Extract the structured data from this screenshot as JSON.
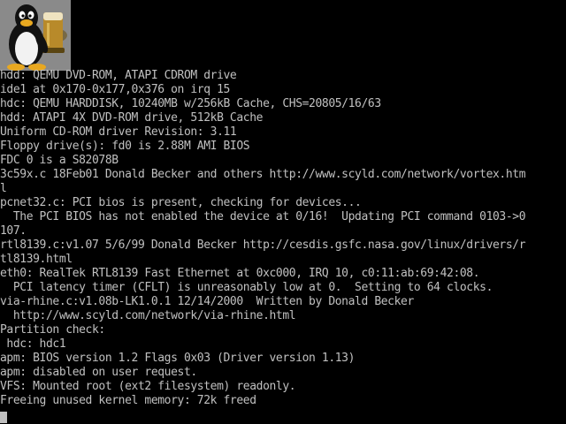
{
  "colors": {
    "background": "#000000",
    "text": "#c0c0c0",
    "logo_background": "#8a8a8a"
  },
  "logo": {
    "icon": "tux-penguin-with-beer-icon"
  },
  "console": {
    "lines": [
      "hdd: QEMU DVD-ROM, ATAPI CDROM drive",
      "ide1 at 0x170-0x177,0x376 on irq 15",
      "hdc: QEMU HARDDISK, 10240MB w/256kB Cache, CHS=20805/16/63",
      "hdd: ATAPI 4X DVD-ROM drive, 512kB Cache",
      "Uniform CD-ROM driver Revision: 3.11",
      "Floppy drive(s): fd0 is 2.88M AMI BIOS",
      "FDC 0 is a S82078B",
      "3c59x.c 18Feb01 Donald Becker and others http://www.scyld.com/network/vortex.htm",
      "l",
      "pcnet32.c: PCI bios is present, checking for devices...",
      "  The PCI BIOS has not enabled the device at 0/16!  Updating PCI command 0103->0",
      "107.",
      "rtl8139.c:v1.07 5/6/99 Donald Becker http://cesdis.gsfc.nasa.gov/linux/drivers/r",
      "tl8139.html",
      "eth0: RealTek RTL8139 Fast Ethernet at 0xc000, IRQ 10, c0:11:ab:69:42:08.",
      "  PCI latency timer (CFLT) is unreasonably low at 0.  Setting to 64 clocks.",
      "via-rhine.c:v1.08b-LK1.0.1 12/14/2000  Written by Donald Becker",
      "  http://www.scyld.com/network/via-rhine.html",
      "Partition check:",
      " hdc: hdc1",
      "apm: BIOS version 1.2 Flags 0x03 (Driver version 1.13)",
      "apm: disabled on user request.",
      "VFS: Mounted root (ext2 filesystem) readonly.",
      "Freeing unused kernel memory: 72k freed"
    ]
  }
}
